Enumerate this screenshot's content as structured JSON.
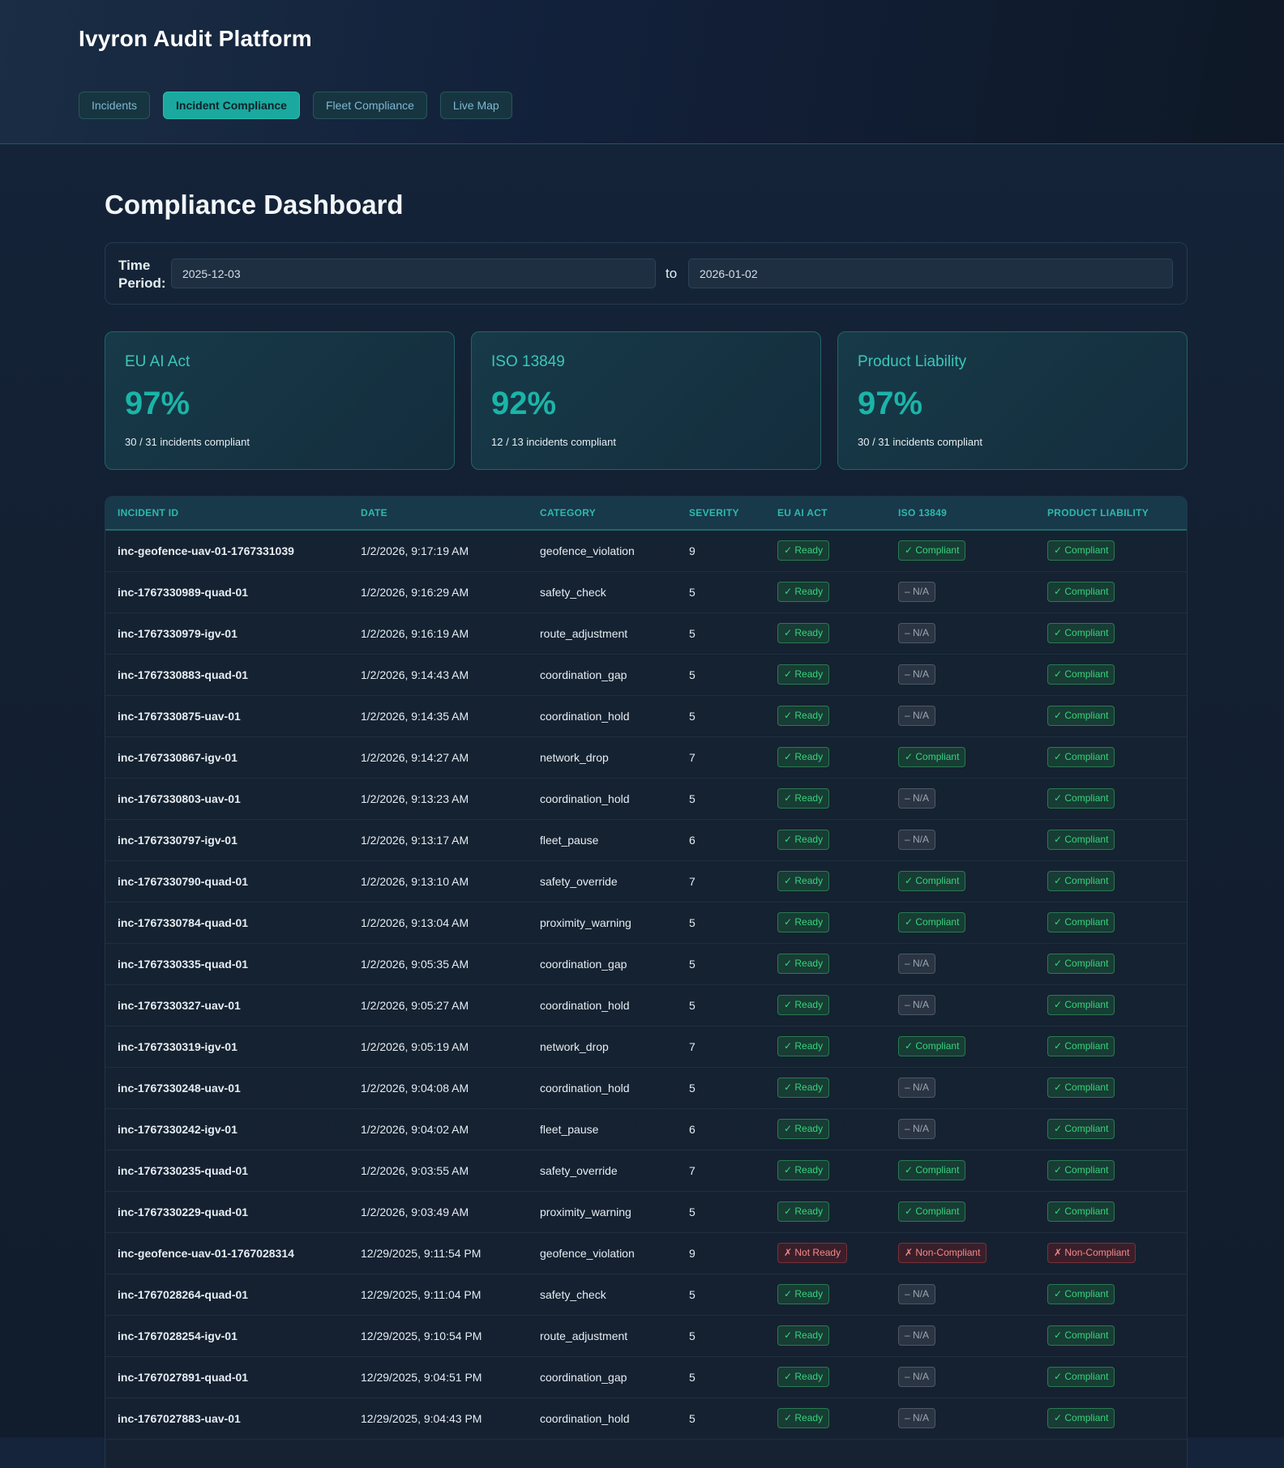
{
  "app": {
    "title": "Ivyron Audit Platform"
  },
  "nav": {
    "tabs": [
      {
        "label": "Incidents",
        "active": false
      },
      {
        "label": "Incident Compliance",
        "active": true
      },
      {
        "label": "Fleet Compliance",
        "active": false
      },
      {
        "label": "Live Map",
        "active": false
      }
    ]
  },
  "page": {
    "title": "Compliance Dashboard"
  },
  "period": {
    "label": "Time Period:",
    "from": "2025-12-03",
    "to_label": "to",
    "to": "2026-01-02"
  },
  "cards": [
    {
      "title": "EU AI Act",
      "value": "97%",
      "sub": "30 / 31 incidents compliant"
    },
    {
      "title": "ISO 13849",
      "value": "92%",
      "sub": "12 / 13 incidents compliant"
    },
    {
      "title": "Product Liability",
      "value": "97%",
      "sub": "30 / 31 incidents compliant"
    }
  ],
  "colors": {
    "accent": "#1ab5a8",
    "ok": "#38d27d",
    "na": "#9aa6b3",
    "bad": "#f08a8a"
  },
  "table": {
    "headers": [
      "INCIDENT ID",
      "DATE",
      "CATEGORY",
      "SEVERITY",
      "EU AI ACT",
      "ISO 13849",
      "PRODUCT LIABILITY"
    ],
    "rows": [
      {
        "id": "inc-geofence-uav-01-1767331039",
        "date": "1/2/2026, 9:17:19 AM",
        "category": "geofence_violation",
        "severity": "9",
        "eu": "✓ Ready",
        "eu_status": "ok",
        "iso": "✓ Compliant",
        "iso_status": "ok",
        "pl": "✓ Compliant",
        "pl_status": "ok"
      },
      {
        "id": "inc-1767330989-quad-01",
        "date": "1/2/2026, 9:16:29 AM",
        "category": "safety_check",
        "severity": "5",
        "eu": "✓ Ready",
        "eu_status": "ok",
        "iso": "– N/A",
        "iso_status": "na",
        "pl": "✓ Compliant",
        "pl_status": "ok"
      },
      {
        "id": "inc-1767330979-igv-01",
        "date": "1/2/2026, 9:16:19 AM",
        "category": "route_adjustment",
        "severity": "5",
        "eu": "✓ Ready",
        "eu_status": "ok",
        "iso": "– N/A",
        "iso_status": "na",
        "pl": "✓ Compliant",
        "pl_status": "ok"
      },
      {
        "id": "inc-1767330883-quad-01",
        "date": "1/2/2026, 9:14:43 AM",
        "category": "coordination_gap",
        "severity": "5",
        "eu": "✓ Ready",
        "eu_status": "ok",
        "iso": "– N/A",
        "iso_status": "na",
        "pl": "✓ Compliant",
        "pl_status": "ok"
      },
      {
        "id": "inc-1767330875-uav-01",
        "date": "1/2/2026, 9:14:35 AM",
        "category": "coordination_hold",
        "severity": "5",
        "eu": "✓ Ready",
        "eu_status": "ok",
        "iso": "– N/A",
        "iso_status": "na",
        "pl": "✓ Compliant",
        "pl_status": "ok"
      },
      {
        "id": "inc-1767330867-igv-01",
        "date": "1/2/2026, 9:14:27 AM",
        "category": "network_drop",
        "severity": "7",
        "eu": "✓ Ready",
        "eu_status": "ok",
        "iso": "✓ Compliant",
        "iso_status": "ok",
        "pl": "✓ Compliant",
        "pl_status": "ok"
      },
      {
        "id": "inc-1767330803-uav-01",
        "date": "1/2/2026, 9:13:23 AM",
        "category": "coordination_hold",
        "severity": "5",
        "eu": "✓ Ready",
        "eu_status": "ok",
        "iso": "– N/A",
        "iso_status": "na",
        "pl": "✓ Compliant",
        "pl_status": "ok"
      },
      {
        "id": "inc-1767330797-igv-01",
        "date": "1/2/2026, 9:13:17 AM",
        "category": "fleet_pause",
        "severity": "6",
        "eu": "✓ Ready",
        "eu_status": "ok",
        "iso": "– N/A",
        "iso_status": "na",
        "pl": "✓ Compliant",
        "pl_status": "ok"
      },
      {
        "id": "inc-1767330790-quad-01",
        "date": "1/2/2026, 9:13:10 AM",
        "category": "safety_override",
        "severity": "7",
        "eu": "✓ Ready",
        "eu_status": "ok",
        "iso": "✓ Compliant",
        "iso_status": "ok",
        "pl": "✓ Compliant",
        "pl_status": "ok"
      },
      {
        "id": "inc-1767330784-quad-01",
        "date": "1/2/2026, 9:13:04 AM",
        "category": "proximity_warning",
        "severity": "5",
        "eu": "✓ Ready",
        "eu_status": "ok",
        "iso": "✓ Compliant",
        "iso_status": "ok",
        "pl": "✓ Compliant",
        "pl_status": "ok"
      },
      {
        "id": "inc-1767330335-quad-01",
        "date": "1/2/2026, 9:05:35 AM",
        "category": "coordination_gap",
        "severity": "5",
        "eu": "✓ Ready",
        "eu_status": "ok",
        "iso": "– N/A",
        "iso_status": "na",
        "pl": "✓ Compliant",
        "pl_status": "ok"
      },
      {
        "id": "inc-1767330327-uav-01",
        "date": "1/2/2026, 9:05:27 AM",
        "category": "coordination_hold",
        "severity": "5",
        "eu": "✓ Ready",
        "eu_status": "ok",
        "iso": "– N/A",
        "iso_status": "na",
        "pl": "✓ Compliant",
        "pl_status": "ok"
      },
      {
        "id": "inc-1767330319-igv-01",
        "date": "1/2/2026, 9:05:19 AM",
        "category": "network_drop",
        "severity": "7",
        "eu": "✓ Ready",
        "eu_status": "ok",
        "iso": "✓ Compliant",
        "iso_status": "ok",
        "pl": "✓ Compliant",
        "pl_status": "ok"
      },
      {
        "id": "inc-1767330248-uav-01",
        "date": "1/2/2026, 9:04:08 AM",
        "category": "coordination_hold",
        "severity": "5",
        "eu": "✓ Ready",
        "eu_status": "ok",
        "iso": "– N/A",
        "iso_status": "na",
        "pl": "✓ Compliant",
        "pl_status": "ok"
      },
      {
        "id": "inc-1767330242-igv-01",
        "date": "1/2/2026, 9:04:02 AM",
        "category": "fleet_pause",
        "severity": "6",
        "eu": "✓ Ready",
        "eu_status": "ok",
        "iso": "– N/A",
        "iso_status": "na",
        "pl": "✓ Compliant",
        "pl_status": "ok"
      },
      {
        "id": "inc-1767330235-quad-01",
        "date": "1/2/2026, 9:03:55 AM",
        "category": "safety_override",
        "severity": "7",
        "eu": "✓ Ready",
        "eu_status": "ok",
        "iso": "✓ Compliant",
        "iso_status": "ok",
        "pl": "✓ Compliant",
        "pl_status": "ok"
      },
      {
        "id": "inc-1767330229-quad-01",
        "date": "1/2/2026, 9:03:49 AM",
        "category": "proximity_warning",
        "severity": "5",
        "eu": "✓ Ready",
        "eu_status": "ok",
        "iso": "✓ Compliant",
        "iso_status": "ok",
        "pl": "✓ Compliant",
        "pl_status": "ok"
      },
      {
        "id": "inc-geofence-uav-01-1767028314",
        "date": "12/29/2025, 9:11:54 PM",
        "category": "geofence_violation",
        "severity": "9",
        "eu": "✗ Not Ready",
        "eu_status": "bad",
        "iso": "✗ Non-Compliant",
        "iso_status": "bad",
        "pl": "✗ Non-Compliant",
        "pl_status": "bad"
      },
      {
        "id": "inc-1767028264-quad-01",
        "date": "12/29/2025, 9:11:04 PM",
        "category": "safety_check",
        "severity": "5",
        "eu": "✓ Ready",
        "eu_status": "ok",
        "iso": "– N/A",
        "iso_status": "na",
        "pl": "✓ Compliant",
        "pl_status": "ok"
      },
      {
        "id": "inc-1767028254-igv-01",
        "date": "12/29/2025, 9:10:54 PM",
        "category": "route_adjustment",
        "severity": "5",
        "eu": "✓ Ready",
        "eu_status": "ok",
        "iso": "– N/A",
        "iso_status": "na",
        "pl": "✓ Compliant",
        "pl_status": "ok"
      },
      {
        "id": "inc-1767027891-quad-01",
        "date": "12/29/2025, 9:04:51 PM",
        "category": "coordination_gap",
        "severity": "5",
        "eu": "✓ Ready",
        "eu_status": "ok",
        "iso": "– N/A",
        "iso_status": "na",
        "pl": "✓ Compliant",
        "pl_status": "ok"
      },
      {
        "id": "inc-1767027883-uav-01",
        "date": "12/29/2025, 9:04:43 PM",
        "category": "coordination_hold",
        "severity": "5",
        "eu": "✓ Ready",
        "eu_status": "ok",
        "iso": "– N/A",
        "iso_status": "na",
        "pl": "✓ Compliant",
        "pl_status": "ok"
      }
    ]
  }
}
